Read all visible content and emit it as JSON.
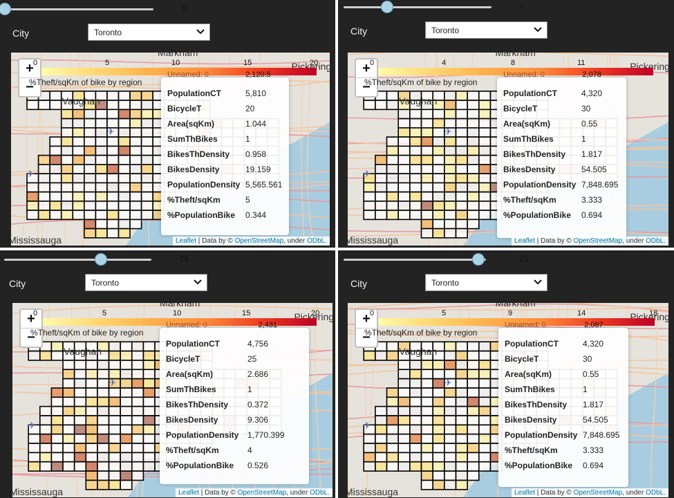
{
  "city_label": "City",
  "legend_caption": "%Theft/sqKm of bike by region",
  "unnamed_label": "Unnamed: 0",
  "attribution": {
    "leaflet": "Leaflet",
    "sep": " | Data by © ",
    "osm": "OpenStreetMap",
    "under": ", under ",
    "odbl": "ODbL."
  },
  "field_labels": [
    "PopulationCT",
    "BicycleT",
    "Area(sqKm)",
    "SumThBikes",
    "BikesThDensity",
    "BikesDensity",
    "PopulationDensity",
    "%Theft/sqKm",
    "%PopulationBike"
  ],
  "places": {
    "vaughan": "Vaughan",
    "markham": "Markham",
    "pickering": "Pickering",
    "mississauga": "Mississauga",
    "marker": "407"
  },
  "colors": {
    "panel": "#232323",
    "water": "#a9cde0",
    "land": "#e6e3dd",
    "accent": "#a9d4e6",
    "link": "#0078a8"
  },
  "panels": [
    {
      "slider_value": "0",
      "slider_fraction": 0.0,
      "city": "Toronto",
      "ticks": [
        "0",
        "5",
        "10",
        "15",
        "20"
      ],
      "max_value": "2,120.5",
      "values": [
        "5,810",
        "20",
        "1.044",
        "1",
        "0.958",
        "19.159",
        "5,565.561",
        "5",
        "0.344"
      ]
    },
    {
      "slider_value": "7",
      "slider_fraction": 0.3,
      "city": "Toronto",
      "ticks": [
        "0",
        "4",
        "8",
        "11",
        ""
      ],
      "max_value": "2,078",
      "values": [
        "4,320",
        "30",
        "0.55",
        "1",
        "1.817",
        "54.505",
        "7,848.695",
        "3.333",
        "0.694"
      ]
    },
    {
      "slider_value": "16",
      "slider_fraction": 0.68,
      "city": "Toronto",
      "ticks": [
        "0",
        "5",
        "10",
        "15",
        "20"
      ],
      "max_value": "2,431",
      "values": [
        "4,756",
        "25",
        "2.686",
        "1",
        "0.372",
        "9.306",
        "1,770.399",
        "4",
        "0.526"
      ]
    },
    {
      "slider_value": "23",
      "slider_fraction": 0.98,
      "city": "Toronto",
      "ticks": [
        "0",
        "5",
        "9",
        "14",
        "18"
      ],
      "max_value": "2,087",
      "values": [
        "4,320",
        "30",
        "0.55",
        "1",
        "1.817",
        "54.505",
        "7,848.695",
        "3.333",
        "0.694"
      ]
    }
  ]
}
